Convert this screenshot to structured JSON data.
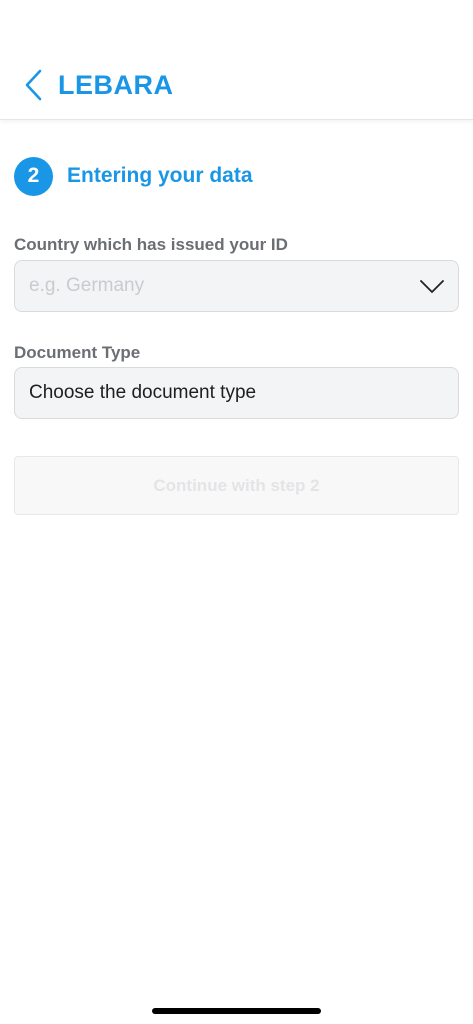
{
  "header": {
    "brand": "LEBARA",
    "back_icon": "chevron-left-icon",
    "accent_color": "#1997e6"
  },
  "step": {
    "number": "2",
    "title": "Entering your data"
  },
  "form": {
    "country": {
      "label": "Country which has issued your ID",
      "placeholder": "e.g. Germany",
      "icon": "chevron-down-icon"
    },
    "document_type": {
      "label": "Document Type",
      "value": "Choose the document type"
    }
  },
  "actions": {
    "continue_label": "Continue with step 2",
    "continue_disabled": true
  }
}
